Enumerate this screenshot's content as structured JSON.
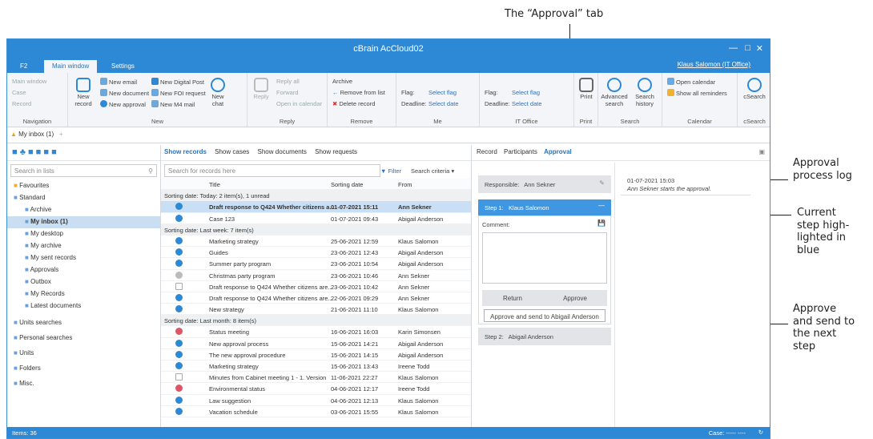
{
  "annotations": {
    "approval_tab": "The “Approval” tab",
    "process_log": "Approval process log",
    "current_step": "Current step high-lighted in blue",
    "approve_send": "Approve and send to the next step"
  },
  "window": {
    "title": "cBrain AcCloud02",
    "user": "Klaus Salomon (IT Office)"
  },
  "ribbon_tabs": [
    "F2",
    "Main window",
    "Settings"
  ],
  "ribbon": {
    "navigation": {
      "label": "Navigation",
      "items": [
        "Main window",
        "Case",
        "Record"
      ]
    },
    "new": {
      "label": "New",
      "big": "New record",
      "items": [
        "New email",
        "New document",
        "New approval",
        "New Digital Post",
        "New FOI request",
        "New M4 mail",
        "New chat"
      ]
    },
    "reply": {
      "label": "Reply",
      "items": [
        "Reply",
        "Reply all",
        "Forward",
        "Open in calendar"
      ]
    },
    "remove": {
      "label": "Remove",
      "items": [
        "Archive",
        "Remove from list",
        "Delete record"
      ]
    },
    "me": {
      "label": "Me",
      "flag": "Flag:",
      "flag_val": "Select flag",
      "deadline": "Deadline:",
      "deadline_val": "Select date"
    },
    "itoffice": {
      "label": "IT Office",
      "flag": "Flag:",
      "flag_val": "Select flag",
      "deadline": "Deadline:",
      "deadline_val": "Select date"
    },
    "print": {
      "label": "Print",
      "big": "Print"
    },
    "search": {
      "label": "Search",
      "adv": "Advanced search",
      "hist": "Search history"
    },
    "calendar": {
      "label": "Calendar",
      "open": "Open calendar",
      "reminders": "Show all reminders"
    },
    "csearch": {
      "label": "cSearch",
      "big": "cSearch"
    }
  },
  "doc_tab": "My inbox (1)",
  "left": {
    "search_placeholder": "Search in lists",
    "items": [
      "Favourites",
      "Standard",
      "Archive",
      "My inbox (1)",
      "My desktop",
      "My archive",
      "My sent records",
      "Approvals",
      "Outbox",
      "My Records",
      "Latest documents",
      "Units searches",
      "Personal searches",
      "Units",
      "Folders",
      "Misc."
    ]
  },
  "middle": {
    "tabs": [
      "Show records",
      "Show cases",
      "Show documents",
      "Show requests"
    ],
    "search_placeholder": "Search for records here",
    "filter": "Filter",
    "criteria": "Search criteria",
    "cols": [
      "Title",
      "Sorting date",
      "From"
    ],
    "groups": [
      {
        "label": "Sorting date: Today: 2 item(s), 1 unread",
        "rows": [
          [
            "Draft response to Q424 Whether citizens a...",
            "01-07-2021 15:11",
            "Ann Sekner"
          ],
          [
            "Case 123",
            "01-07-2021 09:43",
            "Abigail Anderson"
          ]
        ]
      },
      {
        "label": "Sorting date: Last week: 7 item(s)",
        "rows": [
          [
            "Marketing strategy",
            "25-06-2021 12:59",
            "Klaus Salomon"
          ],
          [
            "Guides",
            "23-06-2021 12:43",
            "Abigail Anderson"
          ],
          [
            "Summer party program",
            "23-06-2021 10:54",
            "Abigail Anderson"
          ],
          [
            "Christmas party program",
            "23-06-2021 10:46",
            "Ann Sekner"
          ],
          [
            "Draft response to Q424 Whether citizens are...",
            "23-06-2021 10:42",
            "Ann Sekner"
          ],
          [
            "Draft response to Q424 Whether citizens are...",
            "22-06-2021 09:29",
            "Ann Sekner"
          ],
          [
            "New strategy",
            "21-06-2021 11:10",
            "Klaus Salomon"
          ]
        ]
      },
      {
        "label": "Sorting date: Last month: 8 item(s)",
        "rows": [
          [
            "Status meeting",
            "16-06-2021 16:03",
            "Karin Simonsen"
          ],
          [
            "New approval process",
            "15-06-2021 14:21",
            "Abigail Anderson"
          ],
          [
            "The new approval procedure",
            "15-06-2021 14:15",
            "Abigail Anderson"
          ],
          [
            "Marketing strategy",
            "15-06-2021 13:43",
            "Ireene Todd"
          ],
          [
            "Minutes from Cabinet meeting 1 - 1. Version",
            "11-06-2021 22:27",
            "Klaus Salomon"
          ],
          [
            "Environmental status",
            "04-06-2021 12:17",
            "Ireene Todd"
          ],
          [
            "Law suggestion",
            "04-06-2021 12:13",
            "Klaus Salomon"
          ],
          [
            "Vacation schedule",
            "03-06-2021 15:55",
            "Klaus Salomon"
          ]
        ]
      }
    ]
  },
  "right": {
    "tabs": [
      "Record",
      "Participants",
      "Approval"
    ],
    "responsible_label": "Responsible:",
    "responsible": "Ann Sekner",
    "step1_label": "Step 1:",
    "step1": "Klaus Salomon",
    "comment": "Comment:",
    "return": "Return",
    "approve": "Approve",
    "approve_send": "Approve and send to Abigail Anderson",
    "step2_label": "Step 2:",
    "step2": "Abigail Anderson",
    "log_time": "01-07-2021 15:03",
    "log_text": "Ann Sekner starts the approval."
  },
  "status": {
    "items": "Items: 36",
    "case": "Case: ----- ----"
  },
  "colors": {
    "accent": "#2d88d6",
    "selected_row": "#c8dff5"
  }
}
